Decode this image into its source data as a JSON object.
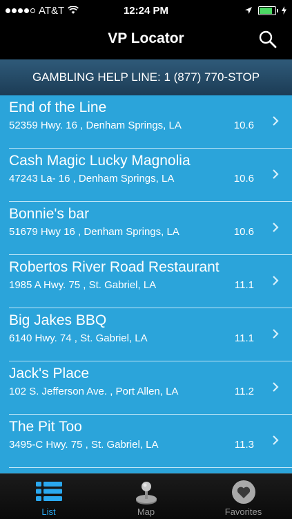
{
  "status": {
    "carrier": "AT&T",
    "time": "12:24 PM",
    "signal_bars": 4,
    "battery_level": 0.9,
    "battery_color": "#4cd964"
  },
  "nav": {
    "title": "VP Locator",
    "search_icon": "search-icon"
  },
  "helpline": "GAMBLING HELP LINE: 1 (877) 770-STOP",
  "locations": [
    {
      "name": "End of the Line",
      "address": "52359 Hwy. 16 , Denham Springs, LA",
      "distance": "10.6"
    },
    {
      "name": "Cash Magic Lucky Magnolia",
      "address": "47243 La- 16 , Denham Springs, LA",
      "distance": "10.6"
    },
    {
      "name": "Bonnie's bar",
      "address": "51679 Hwy 16 , Denham Springs, LA",
      "distance": "10.6"
    },
    {
      "name": "Robertos River Road Restaurant",
      "address": "1985 A Hwy. 75 , St. Gabriel, LA",
      "distance": "11.1"
    },
    {
      "name": "Big Jakes BBQ",
      "address": "6140 Hwy. 74 , St. Gabriel, LA",
      "distance": "11.1"
    },
    {
      "name": "Jack's Place",
      "address": "102 S. Jefferson Ave. , Port Allen, LA",
      "distance": "11.2"
    },
    {
      "name": "The Pit Too",
      "address": "3495-C Hwy. 75 , St. Gabriel, LA",
      "distance": "11.3"
    }
  ],
  "tabs": [
    {
      "label": "List",
      "icon": "list-icon",
      "active": true
    },
    {
      "label": "Map",
      "icon": "joystick-icon",
      "active": false
    },
    {
      "label": "Favorites",
      "icon": "heart-icon",
      "active": false
    }
  ],
  "colors": {
    "list_background": "#2ba4da",
    "accent": "#2aa8ef",
    "helpline_background": "#23475f"
  }
}
